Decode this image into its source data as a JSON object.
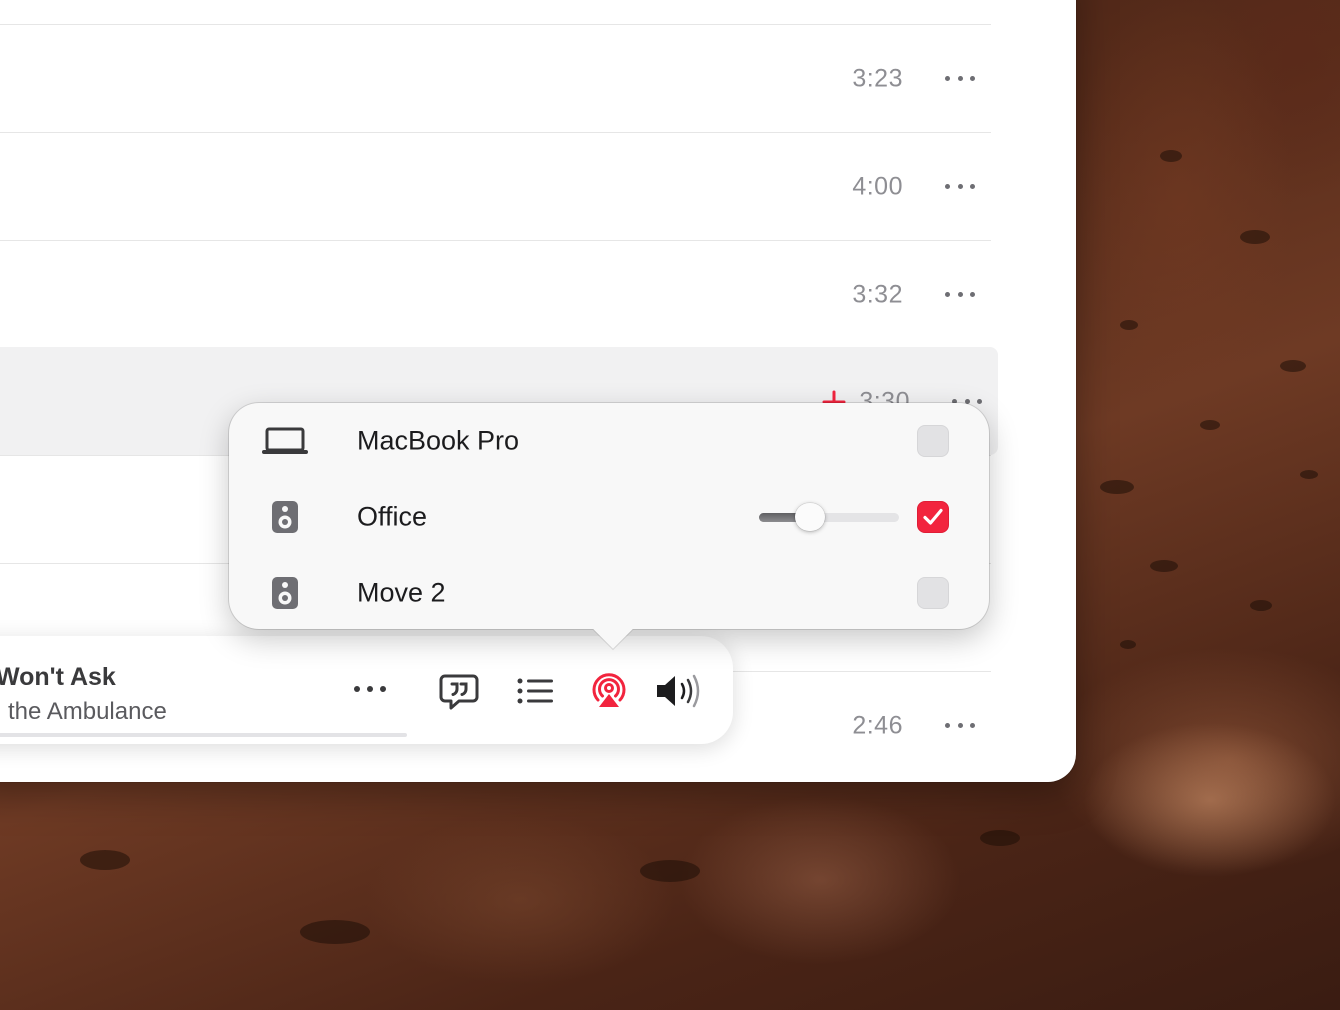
{
  "tracks": [
    {
      "duration": "3:23"
    },
    {
      "duration": "4:00"
    },
    {
      "duration": "3:32"
    },
    {
      "duration": "3:30",
      "selected": true,
      "loved": true
    },
    {
      "duration": ""
    },
    {
      "duration": ""
    },
    {
      "duration": "2:46"
    }
  ],
  "player": {
    "song_title": "Won't Ask",
    "song_artist": "n the Ambulance",
    "progress": 1.0,
    "buttons": [
      "more-icon",
      "lyrics-icon",
      "queue-icon",
      "airplay-icon",
      "volume-icon"
    ]
  },
  "airplay": {
    "devices": [
      {
        "name": "MacBook Pro",
        "icon": "laptop-icon",
        "checked": false
      },
      {
        "name": "Office",
        "icon": "speaker-icon",
        "checked": true,
        "volume": 0.33
      },
      {
        "name": "Move 2",
        "icon": "speaker-icon",
        "checked": false
      }
    ]
  },
  "colors": {
    "accent": "#f2243e",
    "secondary_text": "#8e8e93"
  }
}
